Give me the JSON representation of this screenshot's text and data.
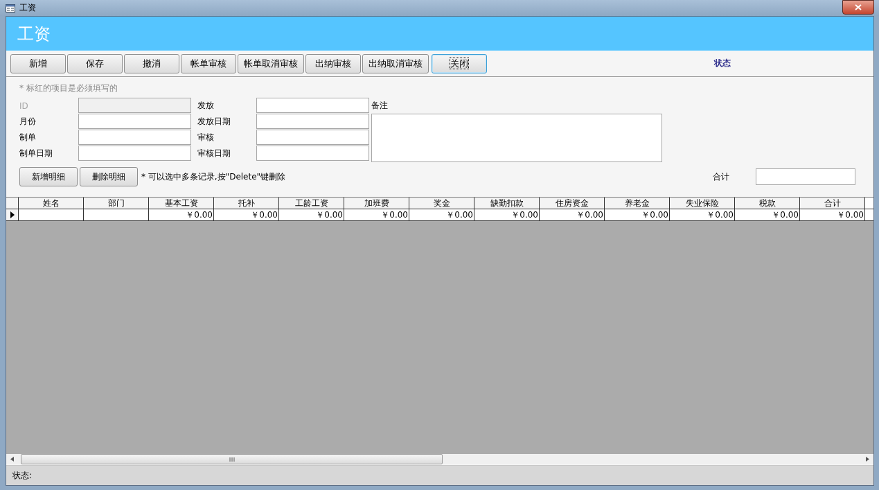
{
  "window": {
    "title": "工资"
  },
  "header": {
    "title": "工资"
  },
  "toolbar": {
    "buttons": [
      {
        "label": "新增",
        "focused": false
      },
      {
        "label": "保存",
        "focused": false
      },
      {
        "label": "撤消",
        "focused": false
      },
      {
        "label": "帐单审核",
        "focused": false
      },
      {
        "label": "帐单取消审核",
        "focused": false
      },
      {
        "label": "出纳审核",
        "focused": false
      },
      {
        "label": "出纳取消审核",
        "focused": false
      },
      {
        "label": "关闭",
        "focused": true
      }
    ],
    "status_label": "状态"
  },
  "form": {
    "hint": "* 标红的项目是必须填写的",
    "fields": [
      {
        "label": "ID",
        "disabled": true
      },
      {
        "label": "月份",
        "disabled": false
      },
      {
        "label": "制单",
        "disabled": false
      },
      {
        "label": "制单日期",
        "disabled": false
      },
      {
        "label": "发放",
        "disabled": false
      },
      {
        "label": "发放日期",
        "disabled": false
      },
      {
        "label": "审核",
        "disabled": false
      },
      {
        "label": "审核日期",
        "disabled": false
      }
    ],
    "remark_label": "备注",
    "detail_buttons": [
      "新增明细",
      "删除明细"
    ],
    "note": "* 可以选中多条记录,按\"Delete\"键删除",
    "total_label": "合计"
  },
  "table": {
    "columns": [
      "姓名",
      "部门",
      "基本工资",
      "托补",
      "工龄工资",
      "加班费",
      "奖金",
      "缺勤扣款",
      "住房资金",
      "养老金",
      "失业保险",
      "税款",
      "合计"
    ],
    "rows": [
      {
        "current": true,
        "cells": [
          null,
          null,
          "￥0.00",
          "￥0.00",
          "￥0.00",
          "￥0.00",
          "￥0.00",
          "￥0.00",
          "￥0.00",
          "￥0.00",
          "￥0.00",
          "￥0.00",
          "￥0.00"
        ]
      }
    ]
  },
  "status_bar": {
    "text": "状态:"
  }
}
